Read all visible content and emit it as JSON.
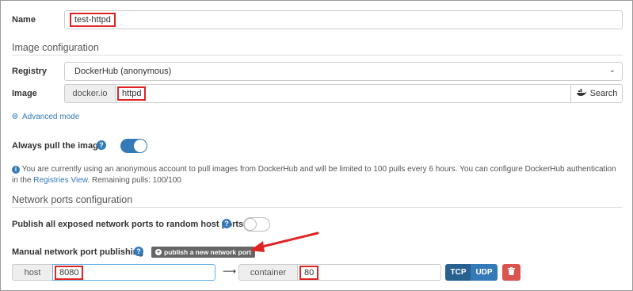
{
  "name": {
    "label": "Name",
    "value": "test-httpd"
  },
  "image_config": {
    "heading": "Image configuration",
    "registry": {
      "label": "Registry",
      "selected": "DockerHub (anonymous)"
    },
    "image": {
      "label": "Image",
      "prefix": "docker.io",
      "value": "httpd",
      "search_label": "Search"
    },
    "advanced_mode": "Advanced mode"
  },
  "always_pull": {
    "label": "Always pull the image",
    "enabled": true
  },
  "info": {
    "text": "You are currently using an anonymous account to pull images from DockerHub and will be limited to 100 pulls every 6 hours. You can configure DockerHub authentication in the",
    "link": "Registries View",
    "text_after": ". Remaining pulls: 100/100"
  },
  "network": {
    "heading": "Network ports configuration",
    "publish_all": {
      "label": "Publish all exposed network ports to random host ports",
      "enabled": false
    },
    "manual": {
      "label": "Manual network port publishing",
      "add_button": "publish a new network port",
      "host_label": "host",
      "host_value": "8080",
      "container_label": "container",
      "container_value": "80",
      "protocols": [
        "TCP",
        "UDP"
      ],
      "selected_protocol": "TCP"
    }
  },
  "colors": {
    "accent": "#337ab7",
    "highlight": "#e02424",
    "toggle_on": "#337ab7",
    "tcp_active": "#286090",
    "delete": "#d9534f"
  }
}
